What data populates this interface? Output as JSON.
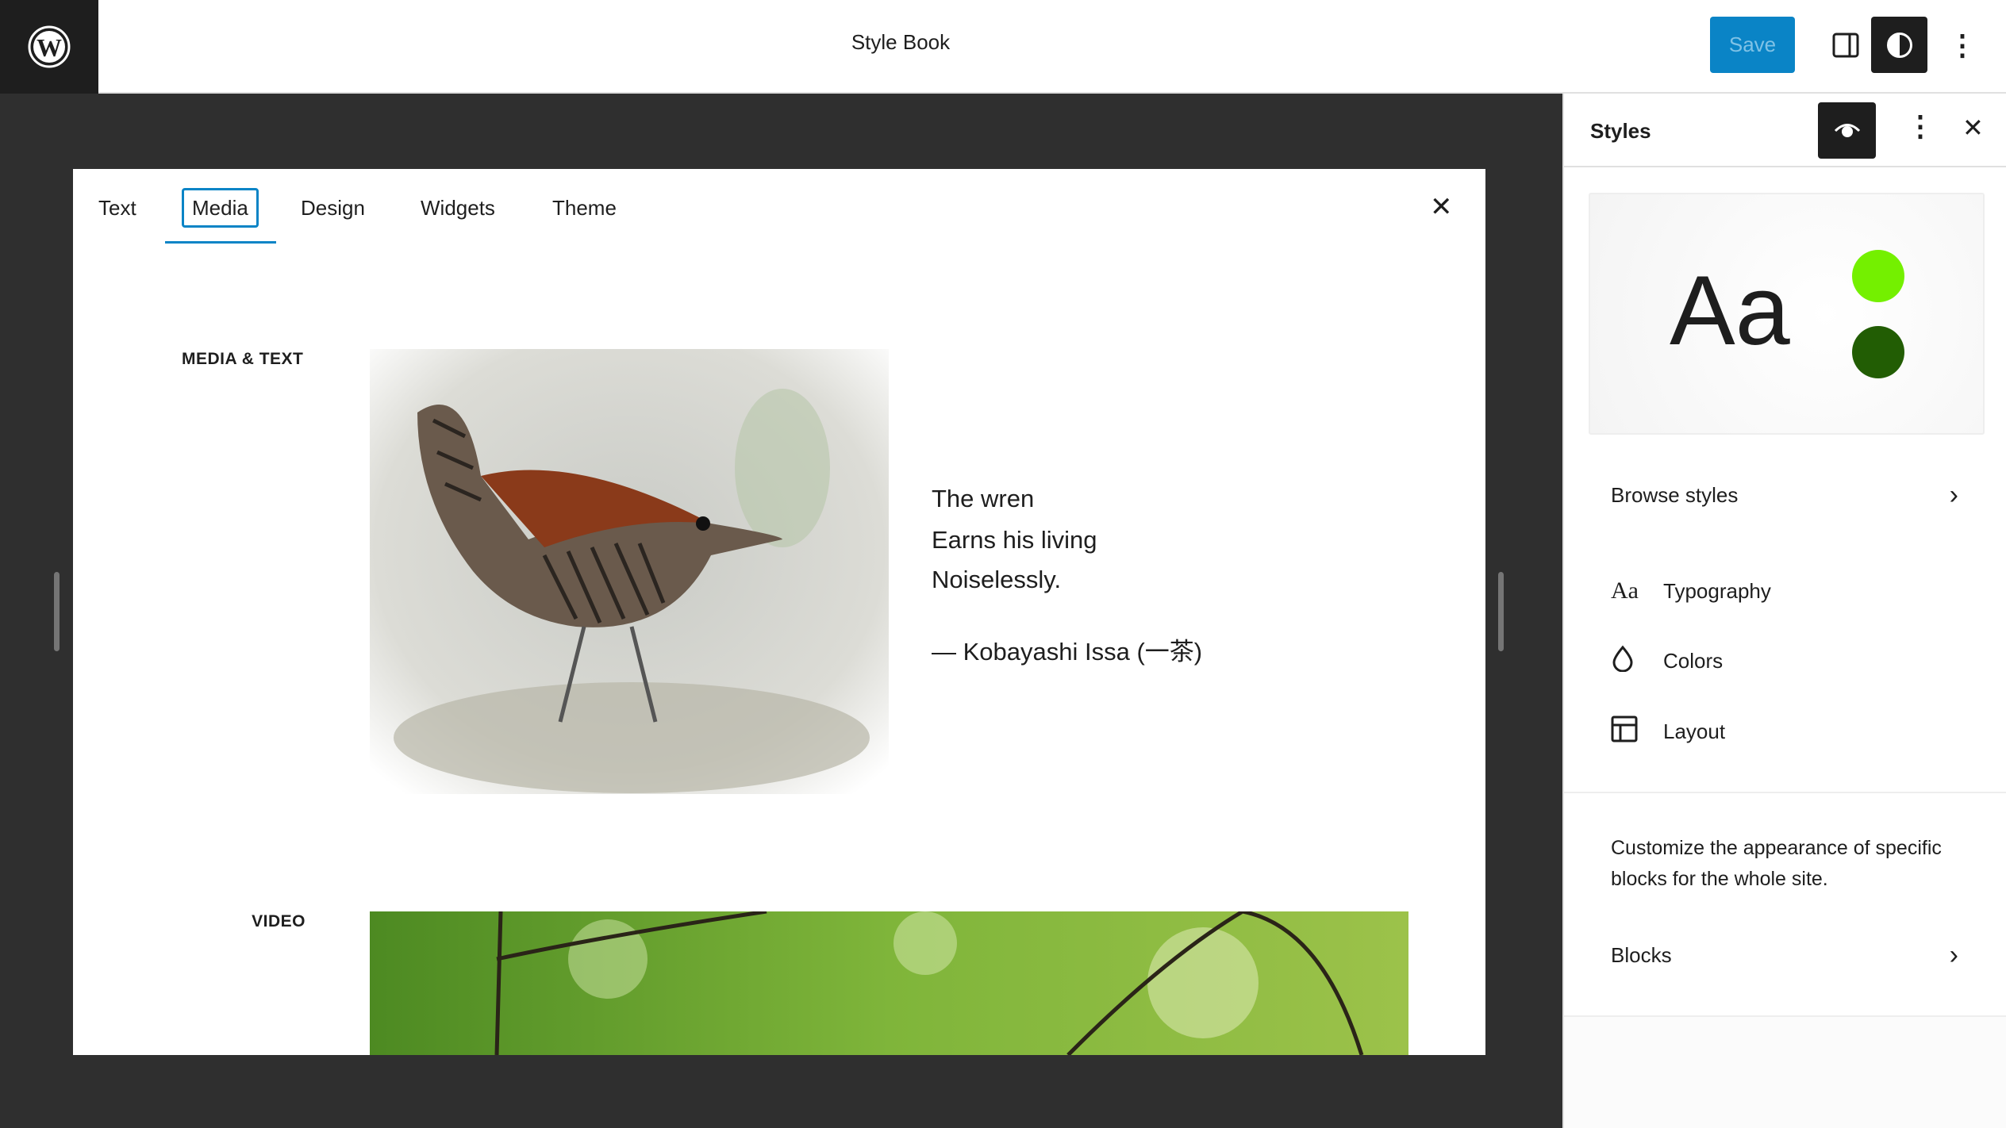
{
  "header": {
    "title": "Style Book",
    "save_label": "Save",
    "icons": [
      "wordpress-logo",
      "sidebar-toggle-icon",
      "contrast-icon",
      "more-vertical-icon"
    ]
  },
  "stylebook": {
    "tabs": [
      {
        "label": "Text"
      },
      {
        "label": "Media",
        "active": true
      },
      {
        "label": "Design"
      },
      {
        "label": "Widgets"
      },
      {
        "label": "Theme"
      }
    ],
    "sections": {
      "media_text_label": "MEDIA & TEXT",
      "video_label": "VIDEO"
    },
    "poem": {
      "lines": [
        "The wren",
        "Earns his living",
        "Noiselessly."
      ],
      "attribution": "— Kobayashi Issa (一茶)"
    }
  },
  "sidebar": {
    "title": "Styles",
    "preview": {
      "sample": "Aa",
      "colors": [
        "#74f000",
        "#225d04"
      ]
    },
    "browse_label": "Browse styles",
    "items": [
      {
        "label": "Typography",
        "icon": "typography-icon"
      },
      {
        "label": "Colors",
        "icon": "droplet-icon"
      },
      {
        "label": "Layout",
        "icon": "layout-icon"
      }
    ],
    "description": "Customize the appearance of specific blocks for the whole site.",
    "blocks_label": "Blocks"
  },
  "colors": {
    "accent": "#0a84c6",
    "dark": "#1e1e1e"
  }
}
